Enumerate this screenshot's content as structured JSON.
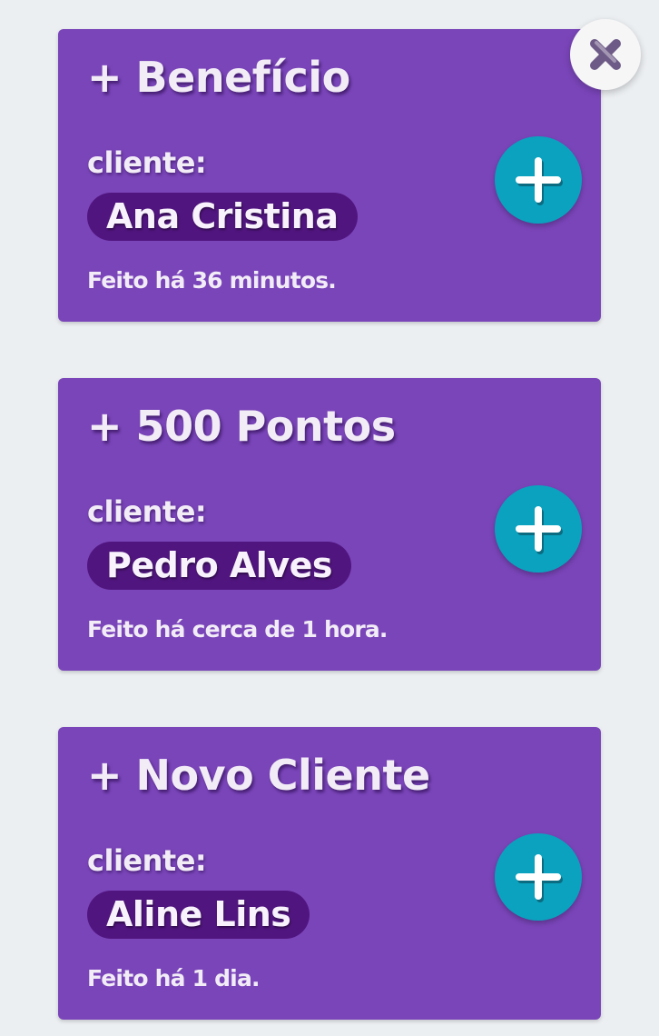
{
  "notifications": [
    {
      "title": "+ Benefício",
      "client_label": "cliente:",
      "client_name": "Ana Cristina",
      "time_ago": "Feito há 36 minutos."
    },
    {
      "title": "+ 500 Pontos",
      "client_label": "cliente:",
      "client_name": "Pedro Alves",
      "time_ago": "Feito há cerca de 1 hora."
    },
    {
      "title": "+ Novo Cliente",
      "client_label": "cliente:",
      "client_name": "Aline Lins",
      "time_ago": "Feito há 1 dia."
    }
  ],
  "icons": {
    "close": "close-icon",
    "plus": "plus-icon"
  },
  "colors": {
    "background": "#eceff2",
    "card": "#7a45b9",
    "client_pill": "#51157f",
    "plus_button": "#0aa2bf",
    "close_button": "#f6f6f7",
    "close_glyph": "#6d5a86"
  }
}
